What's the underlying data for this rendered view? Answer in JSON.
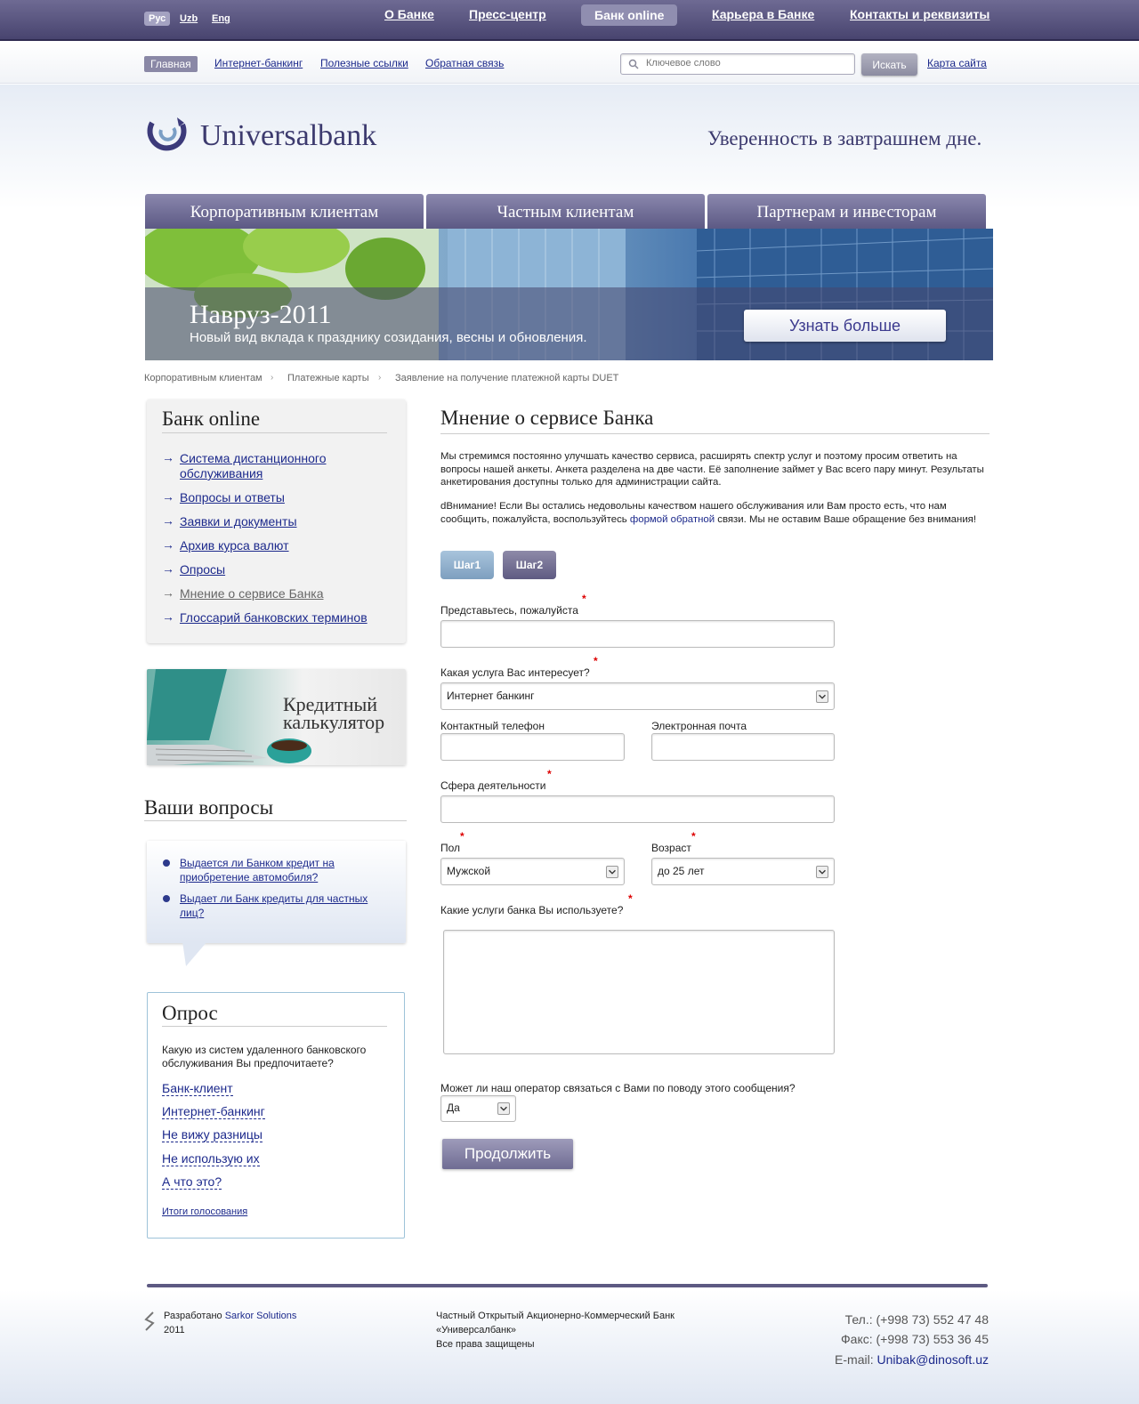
{
  "top_bar": {
    "languages": [
      "Рус",
      "Uzb",
      "Eng"
    ],
    "nav": [
      "О Банке",
      "Пресс-центр",
      "Банк online",
      "Карьера в Банке",
      "Контакты и реквизиты"
    ]
  },
  "sub_bar": {
    "nav": [
      "Главная",
      "Интернет-банкинг",
      "Полезные ссылки",
      "Обратная связь"
    ],
    "search_placeholder": "Ключевое слово",
    "search_button": "Искать",
    "sitemap": "Карта сайта"
  },
  "header": {
    "logo": "Universalbank",
    "slogan": "Уверенность в завтрашнем дне."
  },
  "main_tabs": [
    "Корпоративным клиентам",
    "Частным клиентам",
    "Партнерам и инвесторам"
  ],
  "banner": {
    "title": "Навруз-2011",
    "subtitle": "Новый вид вклада к празднику созидания, весны и обновления.",
    "button": "Узнать больше"
  },
  "breadcrumb": [
    "Корпоративным клиентам",
    "Платежные карты",
    "Заявление на получение платежной карты DUET"
  ],
  "sidebar": {
    "title": "Банк online",
    "items": [
      "Система дистанционного обслуживания",
      "Вопросы и ответы",
      "Заявки и документы",
      "Архив курса валют",
      "Опросы",
      "Мнение о сервисе Банка",
      "Глоссарий банковских терминов"
    ],
    "calculator": "Кредитный калькулятор",
    "questions_title": "Ваши вопросы",
    "questions": [
      "Выдается ли Банком кредит на приобретение автомобиля?",
      "Выдает ли Банк кредиты для частных лиц?"
    ]
  },
  "poll": {
    "title": "Опрос",
    "question": "Какую из систем удаленного банковского обслуживания Вы предпочитаете?",
    "options": [
      "Банк-клиент",
      "Интернет-банкинг",
      "Не вижу разницы",
      "Не использую их",
      "А что это?"
    ],
    "results": "Итоги голосования"
  },
  "main": {
    "title": "Мнение о сервисе Банка",
    "intro": "Мы стремимся постоянно улучшать качество сервиса, расширять спектр услуг и поэтому просим ответить на вопросы нашей анкеты. Анкета разделена на две части. Её заполнение займет у Вас всего пару минут. Результаты анкетирования доступны только для администрации сайта.",
    "notice_before": "dВнимание! Если Вы остались недовольны качеством нашего обслуживания или Вам просто есть, что нам сообщить, пожалуйста, воспользуйтесь ",
    "notice_link": "формой обратной",
    "notice_after": " связи. Мы не оставим Ваше обращение без внимания!",
    "steps": [
      "Шаг1",
      "Шаг2"
    ],
    "form": {
      "name_label": "Представьтесь, пожалуйста",
      "service_label": "Какая услуга Вас интересует?",
      "service_value": "Интернет банкинг",
      "phone_label": "Контактный телефон",
      "email_label": "Электронная почта",
      "sphere_label": "Сфера деятельности",
      "gender_label": "Пол",
      "gender_value": "Мужской",
      "age_label": "Возраст",
      "age_value": "до 25 лет",
      "used_label": "Какие услуги банка Вы используете?",
      "contact_label": "Может ли наш оператор связаться с Вами по поводу этого сообщения?",
      "contact_value": "Да",
      "required_mark": "*",
      "submit": "Продолжить"
    }
  },
  "footer": {
    "dev_prefix": "Разработано ",
    "dev_link": "Sarkor Solutions",
    "dev_year": "2011",
    "bank_line1": "Частный Открытый Акционерно-Коммерческий Банк",
    "bank_line2": "«Универсалбанк»",
    "bank_line3": "Все права защищены",
    "phone": "Тел.: (+998 73) 552 47 48",
    "fax": "Факс: (+998 73) 553 36 45",
    "email_label": "E-mail: ",
    "email": "Unibak@dinosoft.uz"
  },
  "colors": {
    "brand": "#48446f",
    "link": "#1d2a8c",
    "required": "#dd0000"
  }
}
